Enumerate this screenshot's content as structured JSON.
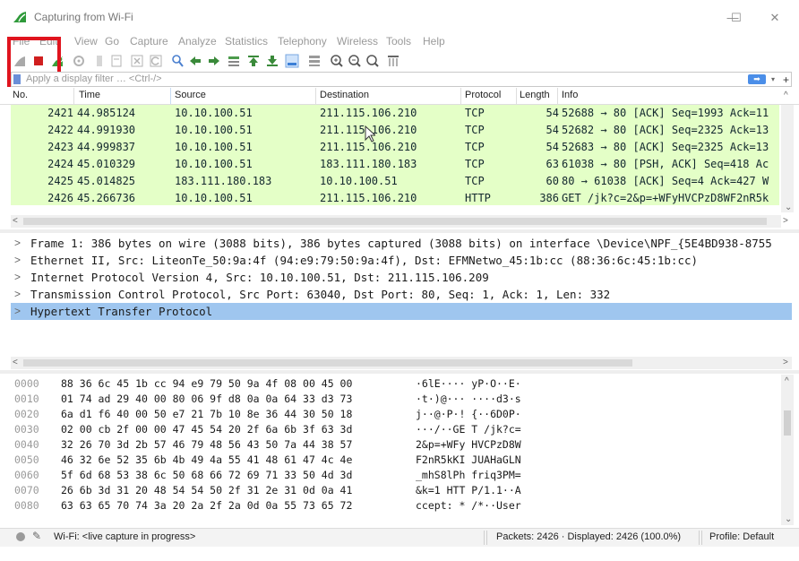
{
  "window": {
    "title": "Capturing from Wi-Fi",
    "minimize": "—",
    "maximize": "☐",
    "close": "✕"
  },
  "menu": [
    "File",
    "Edit",
    "View",
    "Go",
    "Capture",
    "Analyze",
    "Statistics",
    "Telephony",
    "Wireless",
    "Tools",
    "Help"
  ],
  "toolbar_icons": [
    "shark-fin-start-icon",
    "stop-capture-icon",
    "restart-capture-icon",
    "capture-options-icon",
    "open-file-icon",
    "save-file-icon",
    "close-file-icon",
    "reload-icon",
    "find-packet-icon",
    "go-back-icon",
    "go-forward-icon",
    "go-to-packet-icon",
    "go-first-icon",
    "go-last-icon",
    "autoscroll-icon",
    "colorize-icon",
    "zoom-in-icon",
    "zoom-out-icon",
    "zoom-normal-icon",
    "resize-columns-icon"
  ],
  "filter": {
    "placeholder": "Apply a display filter … <Ctrl-/>",
    "apply": "➡",
    "dropdown": "▾",
    "add": "+"
  },
  "columns": [
    "No.",
    "Time",
    "Source",
    "Destination",
    "Protocol",
    "Length",
    "Info"
  ],
  "packets": [
    {
      "no": "2421",
      "time": "44.985124",
      "src": "10.10.100.51",
      "dst": "211.115.106.210",
      "proto": "TCP",
      "len": "54",
      "info": "52688 → 80 [ACK] Seq=1993 Ack=11"
    },
    {
      "no": "2422",
      "time": "44.991930",
      "src": "10.10.100.51",
      "dst": "211.115.106.210",
      "proto": "TCP",
      "len": "54",
      "info": "52682 → 80 [ACK] Seq=2325 Ack=13"
    },
    {
      "no": "2423",
      "time": "44.999837",
      "src": "10.10.100.51",
      "dst": "211.115.106.210",
      "proto": "TCP",
      "len": "54",
      "info": "52683 → 80 [ACK] Seq=2325 Ack=13"
    },
    {
      "no": "2424",
      "time": "45.010329",
      "src": "10.10.100.51",
      "dst": "183.111.180.183",
      "proto": "TCP",
      "len": "63",
      "info": "61038 → 80 [PSH, ACK] Seq=418 Ac"
    },
    {
      "no": "2425",
      "time": "45.014825",
      "src": "183.111.180.183",
      "dst": "10.10.100.51",
      "proto": "TCP",
      "len": "60",
      "info": "80 → 61038 [ACK] Seq=4 Ack=427 W"
    },
    {
      "no": "2426",
      "time": "45.266736",
      "src": "10.10.100.51",
      "dst": "211.115.106.210",
      "proto": "HTTP",
      "len": "386",
      "info": "GET /jk?c=2&p=+WFyHVCPzD8WF2nR5k"
    }
  ],
  "details": [
    {
      "text": "Frame 1: 386 bytes on wire (3088 bits), 386 bytes captured (3088 bits) on interface \\Device\\NPF_{5E4BD938-8755",
      "selected": false
    },
    {
      "text": "Ethernet II, Src: LiteonTe_50:9a:4f (94:e9:79:50:9a:4f), Dst: EFMNetwo_45:1b:cc (88:36:6c:45:1b:cc)",
      "selected": false
    },
    {
      "text": "Internet Protocol Version 4, Src: 10.10.100.51, Dst: 211.115.106.209",
      "selected": false
    },
    {
      "text": "Transmission Control Protocol, Src Port: 63040, Dst Port: 80, Seq: 1, Ack: 1, Len: 332",
      "selected": false
    },
    {
      "text": "Hypertext Transfer Protocol",
      "selected": true
    }
  ],
  "bytes": [
    {
      "offset": "0000",
      "hex": "88 36 6c 45 1b cc 94 e9  79 50 9a 4f 08 00 45 00",
      "ascii": "·6lE···· yP·O··E·"
    },
    {
      "offset": "0010",
      "hex": "01 74 ad 29 40 00 80 06  9f d8 0a 0a 64 33 d3 73",
      "ascii": "·t·)@··· ····d3·s"
    },
    {
      "offset": "0020",
      "hex": "6a d1 f6 40 00 50 e7 21  7b 10 8e 36 44 30 50 18",
      "ascii": "j··@·P·! {··6D0P·"
    },
    {
      "offset": "0030",
      "hex": "02 00 cb 2f 00 00 47 45  54 20 2f 6a 6b 3f 63 3d",
      "ascii": "···/··GE T /jk?c="
    },
    {
      "offset": "0040",
      "hex": "32 26 70 3d 2b 57 46 79  48 56 43 50 7a 44 38 57",
      "ascii": "2&p=+WFy HVCPzD8W"
    },
    {
      "offset": "0050",
      "hex": "46 32 6e 52 35 6b 4b 49  4a 55 41 48 61 47 4c 4e",
      "ascii": "F2nR5kKI JUAHaGLN"
    },
    {
      "offset": "0060",
      "hex": "5f 6d 68 53 38 6c 50 68  66 72 69 71 33 50 4d 3d",
      "ascii": "_mhS8lPh friq3PM="
    },
    {
      "offset": "0070",
      "hex": "26 6b 3d 31 20 48 54 54  50 2f 31 2e 31 0d 0a 41",
      "ascii": "&k=1 HTT P/1.1··A"
    },
    {
      "offset": "0080",
      "hex": "63 63 65 70 74 3a 20 2a  2f 2a 0d 0a 55 73 65 72",
      "ascii": "ccept: * /*··User"
    }
  ],
  "status": {
    "capture": "Wi-Fi: <live capture in progress>",
    "packets": "Packets: 2426 · Displayed: 2426 (100.0%)",
    "profile": "Profile: Default"
  },
  "colors": {
    "row_bg": "#e4ffc7",
    "selected_detail": "#9fc6ef",
    "highlight_box": "#e0141e",
    "accent": "#4b8ee8"
  }
}
